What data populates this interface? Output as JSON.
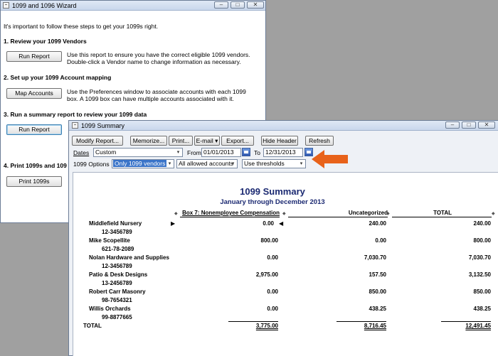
{
  "wizard": {
    "title": "1099 and 1096 Wizard",
    "intro": "It's important to follow these steps to get your 1099s right.",
    "steps": [
      {
        "title": "1. Review your 1099 Vendors",
        "button": "Run Report",
        "desc": "Use this report to ensure you have the correct eligible 1099 vendors. Double-click a Vendor name to change information as necessary."
      },
      {
        "title": "2. Set up your 1099 Account mapping",
        "button": "Map Accounts",
        "desc": "Use the Preferences window to associate accounts with each 1099 box. A 1099 box can have multiple accounts associated with it."
      },
      {
        "title": "3. Run a summary report to review your 1099 data",
        "button": "Run Report",
        "desc": ""
      },
      {
        "title": "4. Print 1099s and 109",
        "button": "Print 1099s",
        "desc": ""
      }
    ]
  },
  "summary": {
    "window_title": "1099 Summary",
    "toolbar": [
      "Modify Report...",
      "Memorize...",
      "Print...",
      "E-mail ▾",
      "Export...",
      "Hide Header",
      "Refresh"
    ],
    "dates_label": "Dates",
    "dates_value": "Custom",
    "from_label": "From",
    "from_value": "01/01/2013",
    "to_label": "To",
    "to_value": "12/31/2013",
    "options_label": "1099 Options",
    "vendors_option": "Only 1099 vendors",
    "accounts_option": "All allowed accounts",
    "thresholds_option": "Use thresholds",
    "report": {
      "title": "1099 Summary",
      "subtitle": "January through December 2013",
      "columns": [
        "Box 7: Nonemployee Compensation",
        "Uncategorized",
        "TOTAL"
      ],
      "rows": [
        {
          "name": "Middlefield Nursery",
          "id": "12-3456789",
          "box7": "0.00",
          "uncat": "240.00",
          "total": "240.00"
        },
        {
          "name": "Mike Scopellite",
          "id": "621-78-2089",
          "box7": "800.00",
          "uncat": "0.00",
          "total": "800.00"
        },
        {
          "name": "Nolan Hardware and Supplies",
          "id": "12-3456789",
          "box7": "0.00",
          "uncat": "7,030.70",
          "total": "7,030.70"
        },
        {
          "name": "Patio & Desk Designs",
          "id": "13-2456789",
          "box7": "2,975.00",
          "uncat": "157.50",
          "total": "3,132.50"
        },
        {
          "name": "Robert Carr Masonry",
          "id": "98-7654321",
          "box7": "0.00",
          "uncat": "850.00",
          "total": "850.00"
        },
        {
          "name": "Willis Orchards",
          "id": "99-8877665",
          "box7": "0.00",
          "uncat": "438.25",
          "total": "438.25"
        }
      ],
      "total": {
        "name": "TOTAL",
        "box7": "3,775.00",
        "uncat": "8,716.45",
        "total": "12,491.45"
      }
    }
  },
  "colors": {
    "accent_arrow": "#e8621a",
    "report_title": "#1c2a72",
    "selection": "#3a74c9"
  }
}
